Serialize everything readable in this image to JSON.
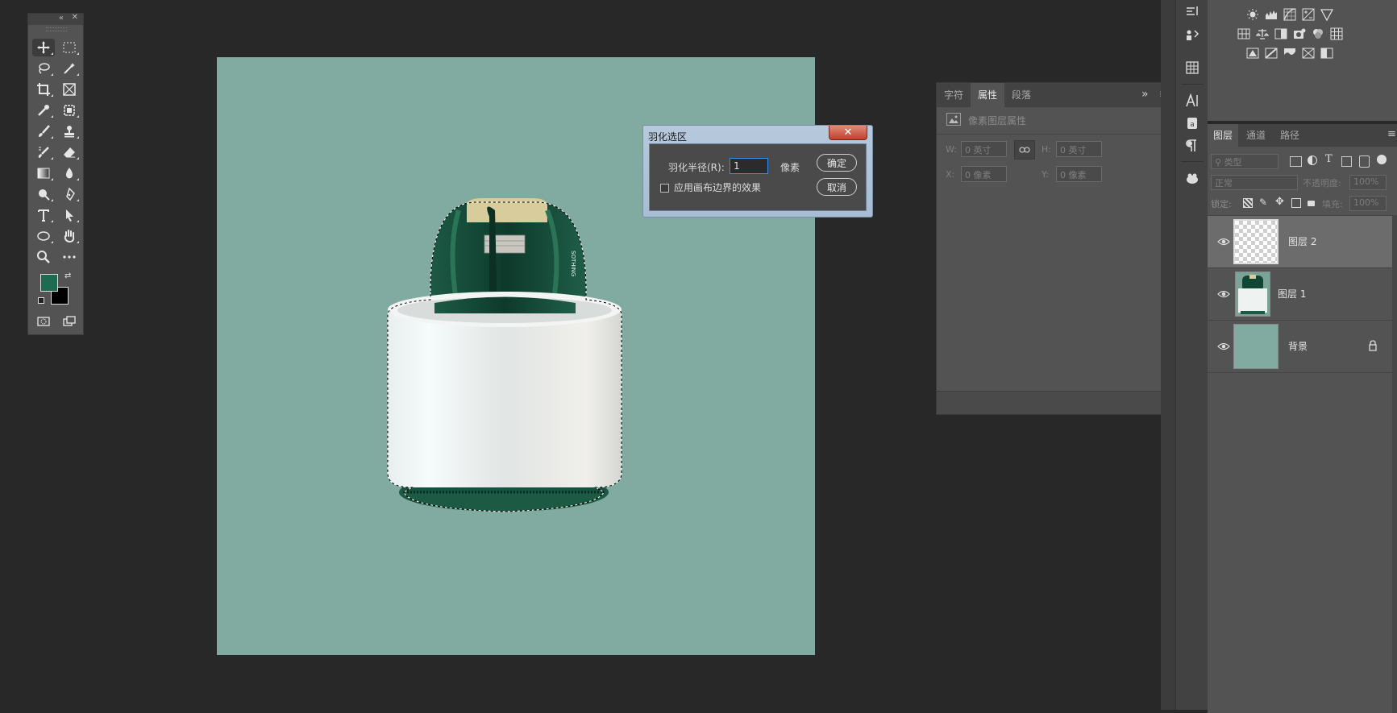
{
  "colors": {
    "canvas_bg": "#81aaa1",
    "foreground_swatch": "#1e6b51",
    "background_swatch": "#000000",
    "selected_layer": "#6c6c6c"
  },
  "feather_dialog": {
    "title": "羽化选区",
    "close_glyph": "✕",
    "radius_label": "羽化半径(R):",
    "radius_value": "1",
    "radius_unit": "像素",
    "apply_canvas_label": "应用画布边界的效果",
    "ok_label": "确定",
    "cancel_label": "取消"
  },
  "properties_panel": {
    "tabs": [
      "字符",
      "属性",
      "段落"
    ],
    "active_tab": "属性",
    "section_title": "像素图层属性",
    "w_label": "W:",
    "w_value": "0 英寸",
    "h_label": "H:",
    "h_value": "0 英寸",
    "x_label": "X:",
    "x_value": "0 像素",
    "y_label": "Y:",
    "y_value": "0 像素",
    "expand_glyph": "»",
    "menu_glyph": "≡"
  },
  "layers_panel": {
    "tabs": [
      "图层",
      "通道",
      "路径"
    ],
    "active_tab": "图层",
    "filter_placeholder": "类型",
    "blend_mode": "正常",
    "opacity_label": "不透明度:",
    "opacity_value": "100%",
    "lock_label": "锁定:",
    "fill_label": "填充:",
    "fill_value": "100%",
    "layers": [
      {
        "name": "图层 2",
        "selected": true
      },
      {
        "name": "图层 1",
        "selected": false
      },
      {
        "name": "背景",
        "selected": false
      }
    ]
  },
  "side_column": {
    "icons": [
      "brush-settings-icon",
      "clone-source-icon",
      "grid-icon",
      "character-icon",
      "glyphs-icon",
      "paragraph-icon",
      "3d-icon"
    ]
  }
}
